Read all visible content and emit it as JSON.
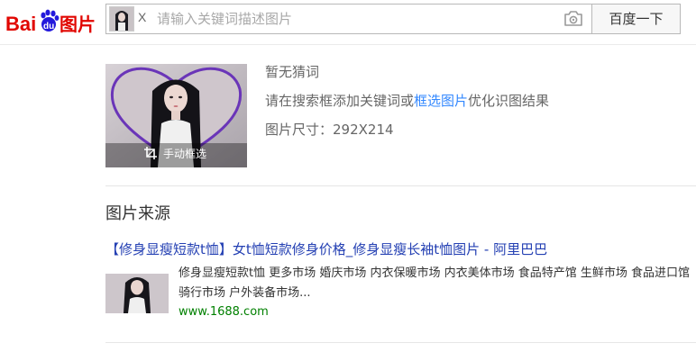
{
  "header": {
    "logo_text": "Bai du 图片",
    "search": {
      "placeholder": "请输入关键词描述图片",
      "value": "",
      "clear_label": "X"
    },
    "search_button_label": "百度一下",
    "icons": [
      "baidu-logo",
      "camera-icon",
      "close-icon"
    ]
  },
  "query": {
    "crop_label": "手动框选",
    "no_guess": "暂无猜词",
    "hint_prefix": "请在搜索框添加关键词或",
    "hint_link": "框选图片",
    "hint_suffix": "优化识图结果",
    "size_label": "图片尺寸：",
    "size_value": "292X214"
  },
  "sources": {
    "title": "图片来源",
    "results": [
      {
        "title": "【修身显瘦短款t恤】女t恤短款修身价格_修身显瘦长袖t恤图片 - 阿里巴巴",
        "description": "修身显瘦短款t恤 更多市场 婚庆市场 内衣保暖市场 内衣美体市场 食品特产馆 生鲜市场 食品进口馆 骑行市场 户外装备市场...",
        "url": "www.1688.com"
      }
    ]
  },
  "colors": {
    "brand_red": "#e10601",
    "brand_blue": "#2319dc",
    "link_blue": "#3388ff",
    "result_title": "#2440b3",
    "url_green": "#008000",
    "heart_frame": "#7b3fc4"
  }
}
